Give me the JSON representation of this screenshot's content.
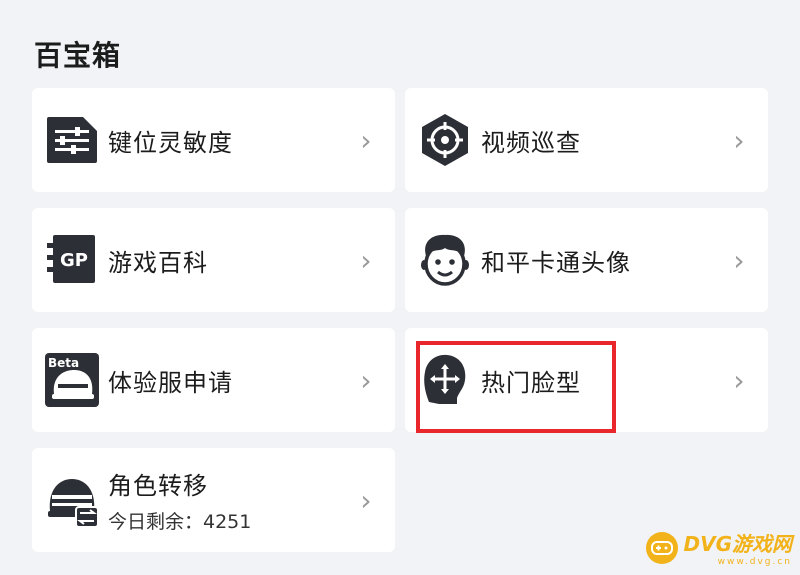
{
  "section": {
    "title": "百宝箱"
  },
  "items": [
    {
      "label": "键位灵敏度",
      "icon": "sliders-icon",
      "chevron": "›"
    },
    {
      "label": "视频巡查",
      "icon": "crosshair-target-icon",
      "chevron": "›"
    },
    {
      "label": "游戏百科",
      "icon": "gp-book-icon",
      "chevron": "›"
    },
    {
      "label": "和平卡通头像",
      "icon": "cartoon-avatar-icon",
      "chevron": "›"
    },
    {
      "label": "体验服申请",
      "icon": "beta-helmet-icon",
      "icon_text": "Beta",
      "chevron": "›"
    },
    {
      "label": "热门脸型",
      "icon": "face-move-icon",
      "chevron": "›"
    },
    {
      "label": "角色转移",
      "sublabel": "今日剩余：4251",
      "icon": "helmet-transfer-icon",
      "chevron": "›"
    }
  ],
  "watermark": {
    "name": "DVG游戏网",
    "url": "www.dvg.cn"
  },
  "colors": {
    "highlight": "#e8262b",
    "icon_dark": "#2c2f36",
    "watermark": "#f2b21a"
  }
}
